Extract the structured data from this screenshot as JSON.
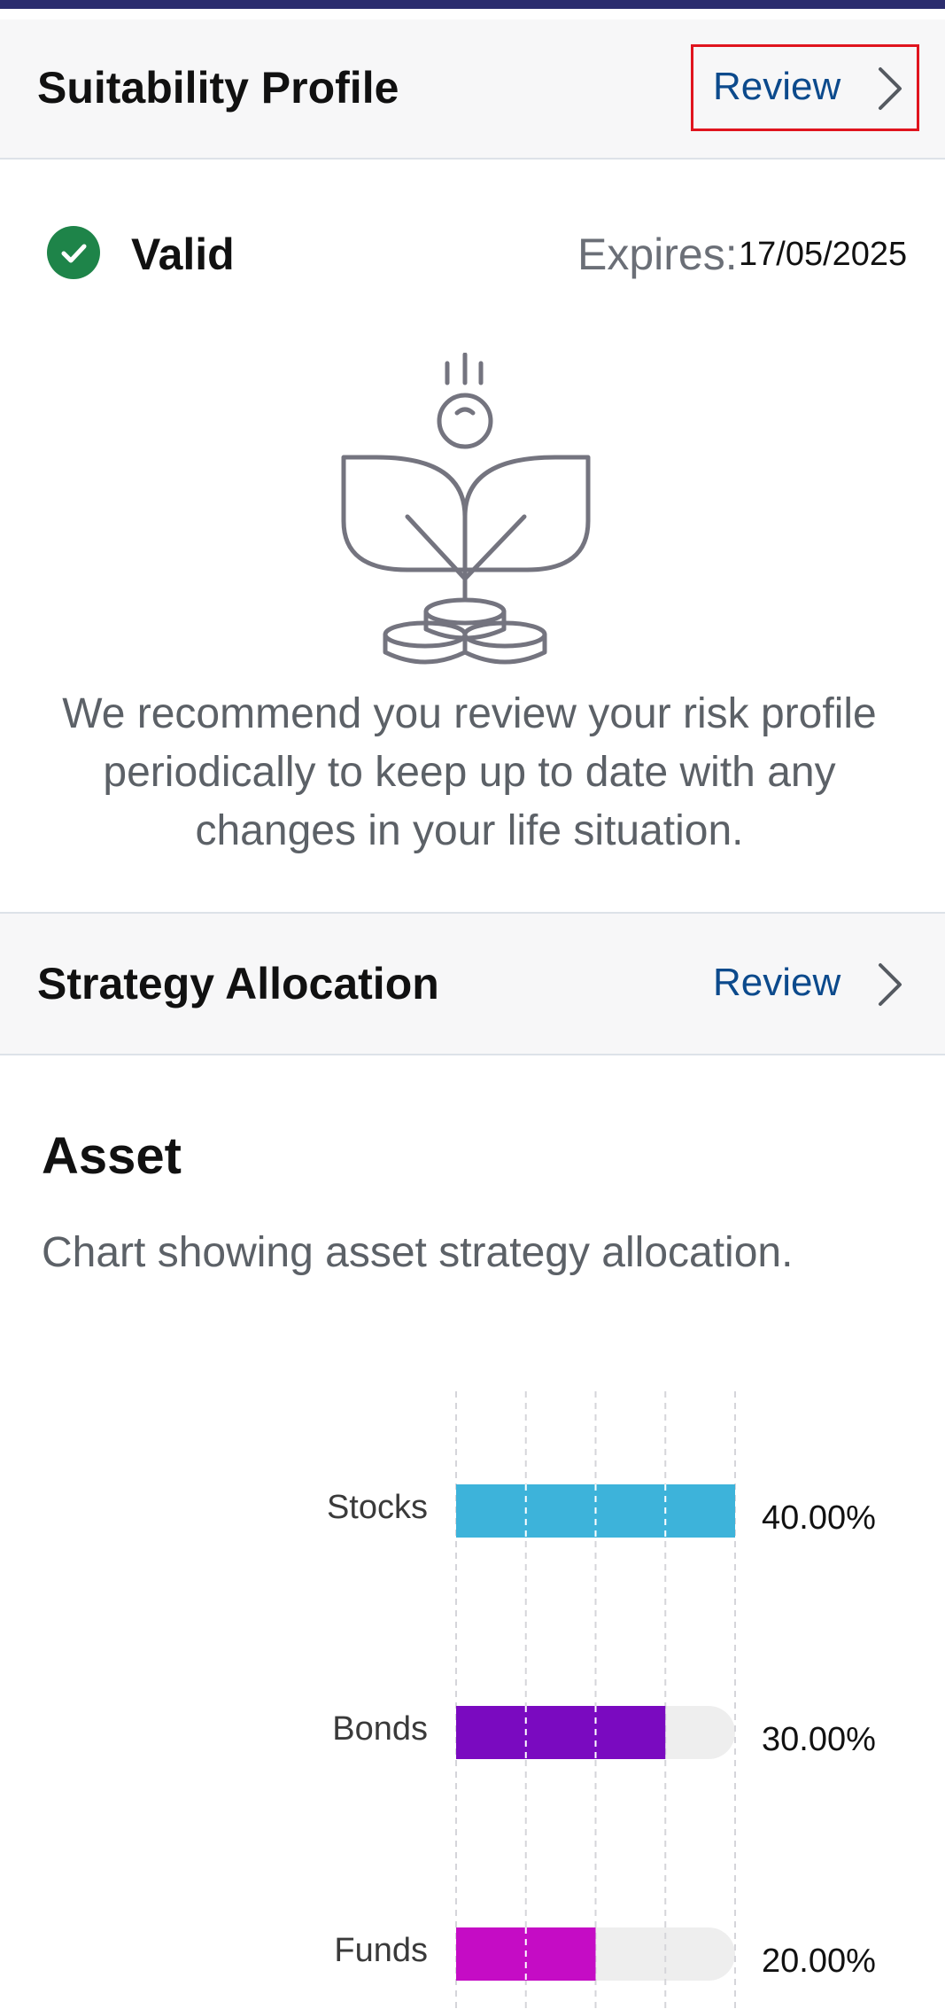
{
  "suitability": {
    "title": "Suitability Profile",
    "review_label": "Review",
    "status": "Valid",
    "expires_label": "Expires:",
    "expires_value": "17/05/2025",
    "recommendation": "We recommend you review your risk profile periodically to keep up to date with any changes in your life situation."
  },
  "strategy": {
    "title": "Strategy Allocation",
    "review_label": "Review"
  },
  "asset": {
    "title": "Asset",
    "description": "Chart showing asset strategy allocation."
  },
  "icons": [
    "chevron-right-icon",
    "check-circle-icon",
    "plant-coins-icon"
  ],
  "colors": {
    "top_bar": "#2b2d6e",
    "link": "#0c4a8c",
    "valid_green": "#1e8449",
    "stocks": "#3db3da",
    "bonds": "#7a0ac0",
    "funds": "#c50cc5",
    "track": "#eeeeee",
    "highlight": "#e0141e"
  },
  "chart_data": {
    "type": "bar",
    "orientation": "horizontal",
    "categories": [
      "Stocks",
      "Bonds",
      "Funds"
    ],
    "values": [
      40,
      30,
      20
    ],
    "value_labels": [
      "40.00%",
      "30.00%",
      "20.00%"
    ],
    "xlim": [
      0,
      40
    ],
    "grid": true,
    "title": "",
    "xlabel": "",
    "ylabel": ""
  }
}
